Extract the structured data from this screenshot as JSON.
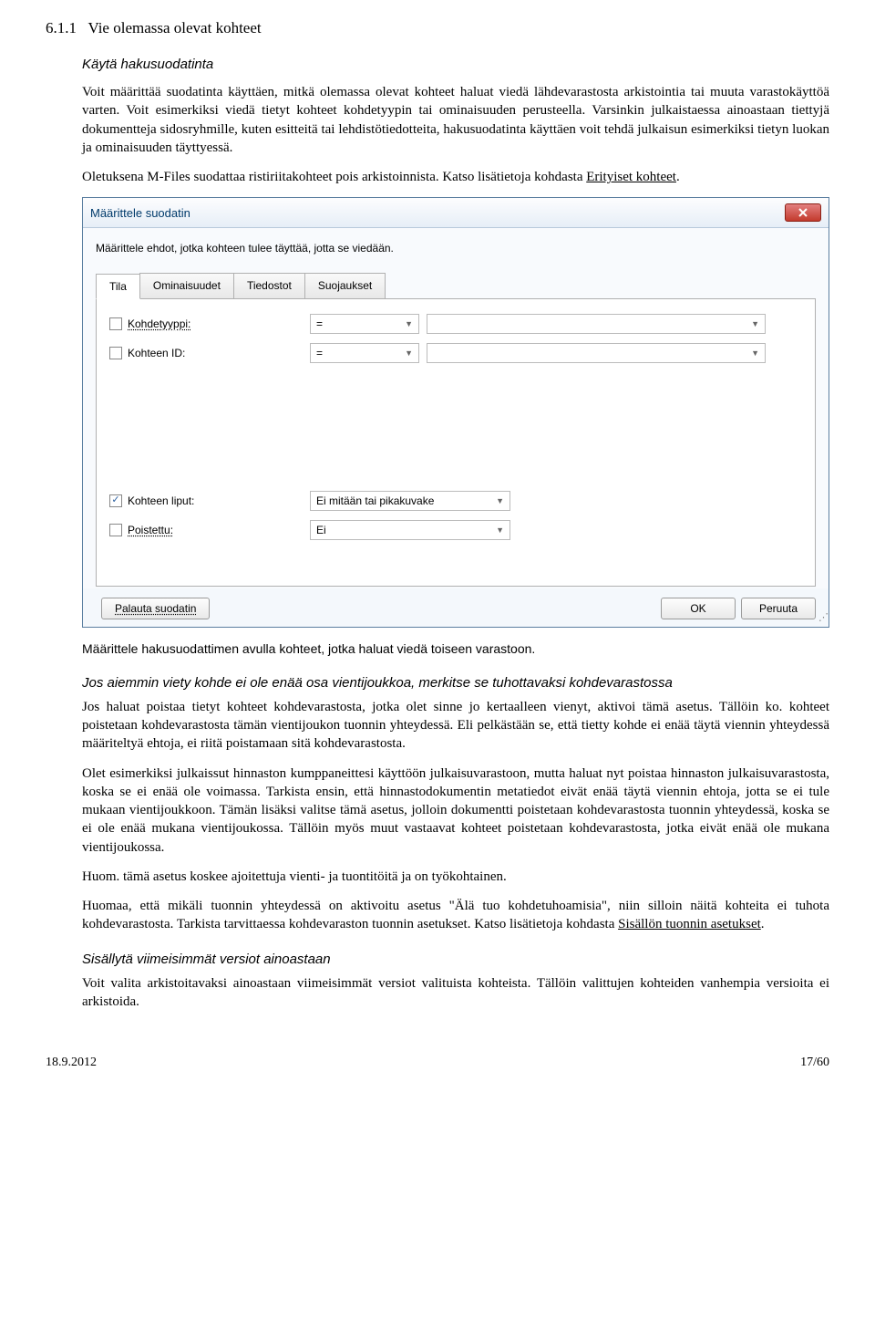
{
  "section": {
    "number": "6.1.1",
    "title": "Vie olemassa olevat kohteet"
  },
  "h_intro": "Käytä hakusuodatinta",
  "p1": "Voit määrittää suodatinta käyttäen, mitkä olemassa olevat kohteet haluat viedä lähdevarastosta arkistointia tai muuta varastokäyttöä varten. Voit esimerkiksi viedä tietyt kohteet kohdetyypin tai ominaisuuden perusteella. Varsinkin julkaistaessa ainoastaan tiettyjä dokumentteja sidosryhmille, kuten esitteitä tai lehdistötiedotteita, hakusuodatinta käyttäen voit tehdä julkaisun esimerkiksi tietyn luokan ja ominaisuuden täyttyessä.",
  "p2a": "Oletuksena M-Files suodattaa ristiriitakohteet pois arkistoinnista. Katso lisätietoja kohdasta ",
  "p2b_link": "Erityiset kohteet",
  "p2c": ".",
  "dialog": {
    "title": "Määrittele suodatin",
    "desc": "Määrittele ehdot, jotka kohteen tulee täyttää, jotta se viedään.",
    "tabs": {
      "t1": "Tila",
      "t2": "Ominaisuudet",
      "t3": "Tiedostot",
      "t4": "Suojaukset"
    },
    "rows": {
      "r1": {
        "label": "Kohdetyyppi:",
        "op": "=",
        "val": ""
      },
      "r2": {
        "label": "Kohteen ID:",
        "op": "=",
        "val": ""
      },
      "r3": {
        "label": "Kohteen liput:",
        "op": "",
        "val": "Ei mitään tai pikakuvake"
      },
      "r4": {
        "label": "Poistettu:",
        "op": "",
        "val": "Ei"
      }
    },
    "buttons": {
      "reset": "Palauta suodatin",
      "ok": "OK",
      "cancel": "Peruuta"
    }
  },
  "caption": "Määrittele hakusuodattimen avulla kohteet, jotka haluat viedä toiseen varastoon.",
  "h_jos": "Jos aiemmin viety kohde ei ole enää osa vientijoukkoa, merkitse se tuhottavaksi kohdevarastossa",
  "p3": "Jos haluat poistaa tietyt kohteet kohdevarastosta, jotka olet sinne jo kertaalleen vienyt, aktivoi tämä asetus. Tällöin ko. kohteet poistetaan kohdevarastosta tämän vientijoukon tuonnin yhteydessä. Eli pelkästään se, että tietty kohde ei enää täytä viennin yhteydessä määriteltyä ehtoja, ei riitä poistamaan sitä kohdevarastosta.",
  "p4": "Olet esimerkiksi julkaissut hinnaston kumppaneittesi käyttöön julkaisuvarastoon, mutta haluat nyt poistaa hinnaston julkaisuvarastosta, koska se ei enää ole voimassa. Tarkista ensin, että hinnastodokumentin metatiedot eivät enää täytä viennin ehtoja, jotta se ei tule mukaan vientijoukkoon. Tämän lisäksi valitse tämä asetus, jolloin dokumentti poistetaan kohdevarastosta tuonnin yhteydessä, koska se ei ole enää mukana vientijoukossa. Tällöin myös muut vastaavat kohteet poistetaan kohdevarastosta, jotka eivät enää ole mukana vientijoukossa.",
  "p5": "Huom. tämä asetus koskee ajoitettuja vienti- ja tuontitöitä ja on työkohtainen.",
  "p6a": "Huomaa, että mikäli tuonnin yhteydessä on aktivoitu asetus \"Älä tuo kohdetuhoamisia\", niin silloin näitä kohteita ei tuhota kohdevarastosta. Tarkista tarvittaessa kohdevaraston tuonnin asetukset. Katso lisätietoja kohdasta ",
  "p6b_link": "Sisällön tuonnin asetukset",
  "p6c": ".",
  "h_sis": "Sisällytä viimeisimmät versiot ainoastaan",
  "p7": "Voit valita arkistoitavaksi ainoastaan viimeisimmät versiot valituista kohteista. Tällöin valittujen kohteiden vanhempia versioita ei arkistoida.",
  "footer": {
    "date": "18.9.2012",
    "page": "17/60"
  }
}
